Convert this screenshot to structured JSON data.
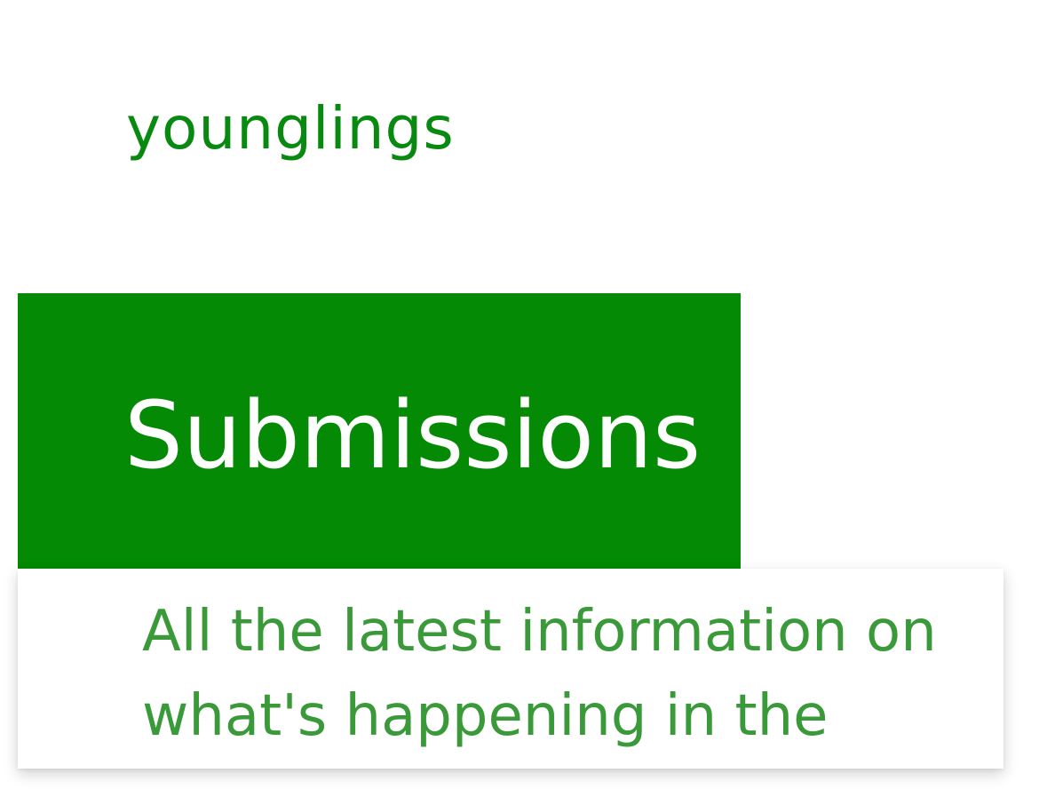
{
  "header": {
    "brand": "younglings"
  },
  "hero": {
    "title": "Submissions"
  },
  "card": {
    "description": "All the latest information on what's happening in the"
  },
  "colors": {
    "brand_green": "#088a10",
    "hero_background": "#048a04",
    "description_green": "#3a9a3a"
  }
}
